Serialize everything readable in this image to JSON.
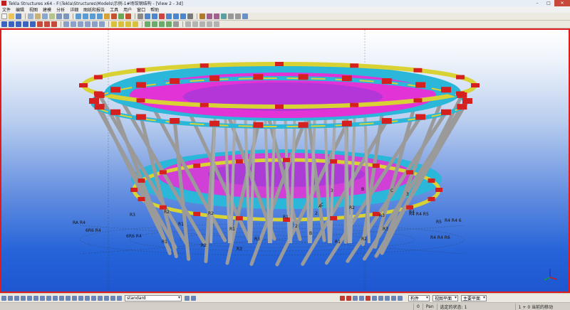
{
  "window": {
    "title": "Tekla Structures x64 - F:\\Tekla\\Structures\\Models\\示例-1#场馆钢结构 - [View 2 - 3d]",
    "minimize": "–",
    "maximize": "□",
    "close": "✕"
  },
  "menu": [
    "文件",
    "编辑",
    "视图",
    "建模",
    "分析",
    "详细",
    "图纸和报告",
    "工具",
    "用户",
    "窗口",
    "帮助"
  ],
  "statusbar": {
    "view_filter": "standard",
    "dropdowns": [
      "构件",
      "视图平面",
      "主要平面"
    ]
  },
  "infobar": {
    "field1": "0",
    "field2": "Pan",
    "field3": "选定的状态: 1",
    "field4": "1 + 0 当前的移动"
  },
  "grid_labels": {
    "left": [
      "RA R4",
      "6R6 R4",
      "R3",
      "R2",
      "R1",
      "6R6 R4",
      "R1",
      "R2",
      "R3"
    ],
    "center": [
      "R2",
      "R1",
      "R3",
      "A",
      "B",
      "C",
      "2",
      "3",
      "R1",
      "R2",
      "R3",
      "R4",
      "R5"
    ],
    "right": [
      "R4 R4 R5",
      "R4 R4 6",
      "R4 R4 R6",
      "R3",
      "R2",
      "R1",
      "2",
      "3",
      "C",
      "B"
    ]
  },
  "colors": {
    "frame_border": "#e01b1b",
    "ring_yellow": "#d9d234",
    "ring_cyan": "#2ab7d9",
    "magenta": "#e233d6",
    "joint_red": "#d62020",
    "column_grey": "#9a9a9a"
  }
}
